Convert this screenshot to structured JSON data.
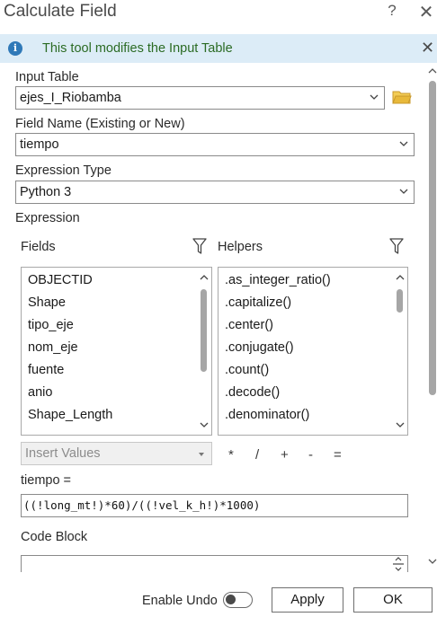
{
  "window": {
    "title": "Calculate Field",
    "help_glyph": "?",
    "close_glyph": "✕"
  },
  "banner": {
    "text": "This tool modifies the Input Table",
    "icon": "info-icon",
    "close_glyph": "✕"
  },
  "input_table": {
    "label": "Input Table",
    "value": "ejes_I_Riobamba",
    "icon": "folder-icon"
  },
  "field_name": {
    "label": "Field Name (Existing or New)",
    "value": "tiempo"
  },
  "expression_type": {
    "label": "Expression Type",
    "value": "Python 3"
  },
  "expression": {
    "label": "Expression",
    "fields_label": "Fields",
    "helpers_label": "Helpers",
    "fields": [
      "OBJECTID",
      "Shape",
      "tipo_eje",
      "nom_eje",
      "fuente",
      "anio",
      "Shape_Length"
    ],
    "helpers": [
      ".as_integer_ratio()",
      ".capitalize()",
      ".center()",
      ".conjugate()",
      ".count()",
      ".decode()",
      ".denominator()"
    ],
    "insert_values_placeholder": "Insert Values",
    "operators": [
      "*",
      "/",
      "+",
      "-",
      "="
    ],
    "target_label": "tiempo =",
    "value": "((!long_mt!)*60)/((!vel_k_h!)*1000)"
  },
  "code_block": {
    "label": "Code Block"
  },
  "footer": {
    "enable_undo_label": "Enable Undo",
    "enable_undo_on": false,
    "apply_label": "Apply",
    "ok_label": "OK"
  },
  "colors": {
    "banner_bg": "#dcecf7",
    "banner_text": "#2b6b24",
    "info_icon": "#2f79b8",
    "folder": "#e8b93a"
  }
}
